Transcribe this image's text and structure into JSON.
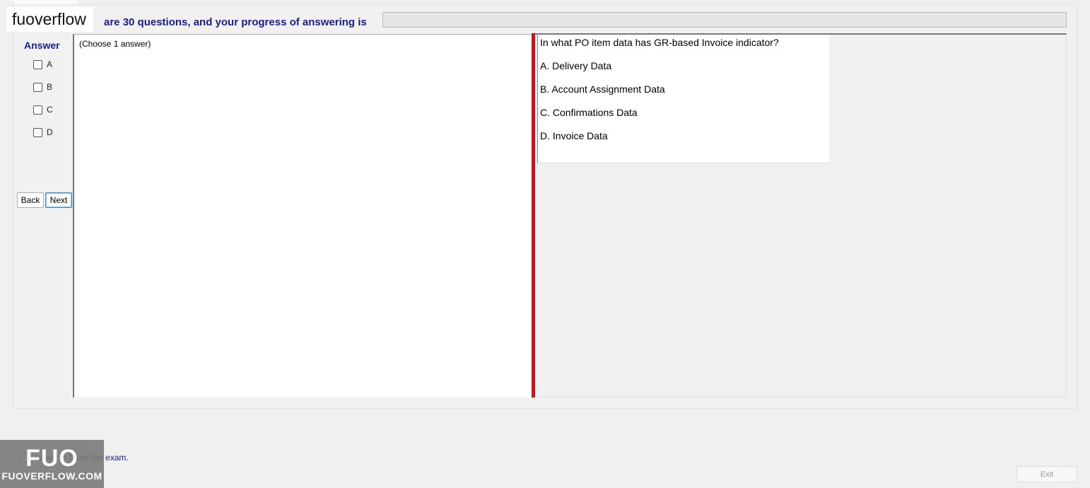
{
  "watermark_label": "fuoverflow",
  "progress": {
    "text": "are 30 questions, and your progress of answering is",
    "value_fraction": 0.0,
    "fill_color": "#06b025"
  },
  "answer_panel": {
    "title": "Answer",
    "options": [
      "A",
      "B",
      "C",
      "D"
    ]
  },
  "nav": {
    "back_label": "Back",
    "next_label": "Next"
  },
  "question_panel": {
    "instruction": "(Choose 1 answer)"
  },
  "question": {
    "text": "In what PO item data has GR-based Invoice indicator?",
    "options": [
      "A.  Delivery Data",
      "B.  Account Assignment Data",
      "C.  Confirmations Data",
      "D.  Invoice Data"
    ]
  },
  "finish": {
    "label": "I want to finish the exam."
  },
  "exit_label": "Exit",
  "logo": {
    "big": "FUO",
    "small": "FUOVERFLOW.COM"
  },
  "colors": {
    "accent": "#1c1c8e",
    "divider": "#c8141e"
  }
}
